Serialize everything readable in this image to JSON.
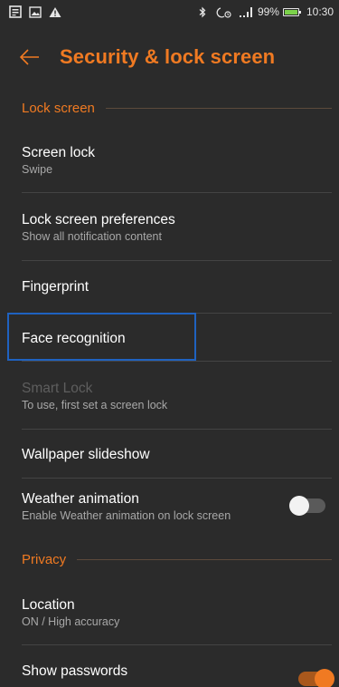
{
  "status_bar": {
    "battery_percent": "99%",
    "time": "10:30",
    "battery_level": 0.99,
    "icons": [
      "notes-icon",
      "image-icon",
      "warning-icon",
      "bluetooth-icon",
      "alarm-icon",
      "signal-icon",
      "battery-icon"
    ]
  },
  "app_bar": {
    "title": "Security & lock screen",
    "back_icon": "back-arrow-icon"
  },
  "sections": {
    "lock_screen": "Lock screen",
    "privacy": "Privacy"
  },
  "items": {
    "screen_lock": {
      "title": "Screen lock",
      "subtitle": "Swipe"
    },
    "lock_screen_preferences": {
      "title": "Lock screen preferences",
      "subtitle": "Show all notification content"
    },
    "fingerprint": {
      "title": "Fingerprint"
    },
    "face_recognition": {
      "title": "Face recognition"
    },
    "smart_lock": {
      "title": "Smart Lock",
      "subtitle": "To use, first set a screen lock"
    },
    "wallpaper_slideshow": {
      "title": "Wallpaper slideshow"
    },
    "weather_animation": {
      "title": "Weather animation",
      "subtitle": "Enable Weather animation on lock screen",
      "toggle": "off"
    },
    "location": {
      "title": "Location",
      "subtitle": "ON / High accuracy"
    },
    "show_passwords": {
      "title": "Show passwords",
      "toggle": "on"
    }
  },
  "colors": {
    "accent": "#f07a22",
    "background": "#2b2b2b",
    "focus_outline": "#1f62c0"
  }
}
